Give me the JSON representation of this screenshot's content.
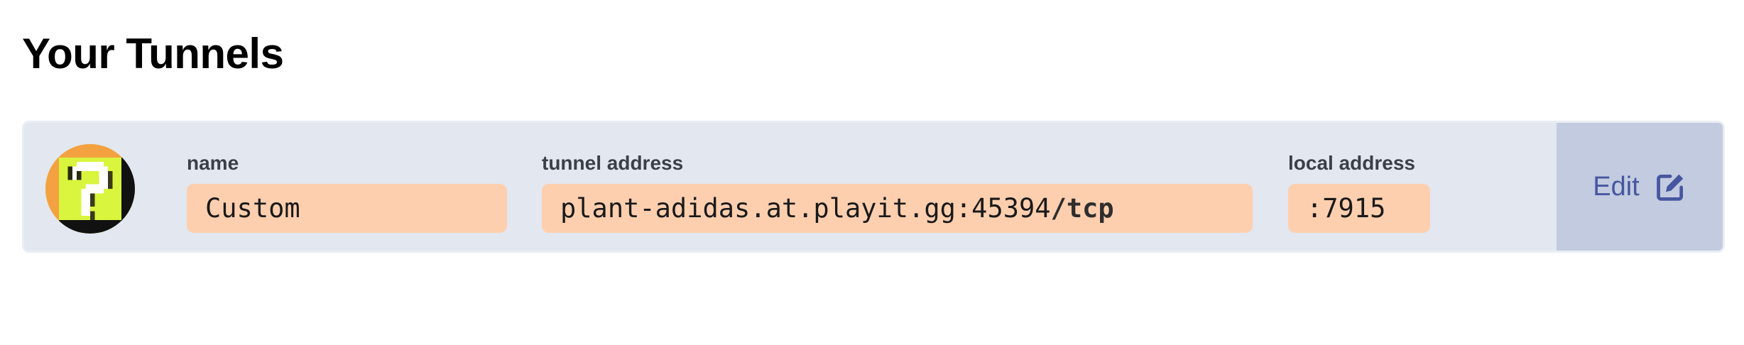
{
  "page": {
    "title": "Your Tunnels"
  },
  "tunnel": {
    "avatar_icon": "question-block-icon",
    "name_label": "name",
    "name_value": "Custom",
    "tunnel_address_label": "tunnel address",
    "tunnel_address_host": "plant-adidas.at.playit.gg:45394",
    "tunnel_address_separator": "/",
    "tunnel_address_protocol": "tcp",
    "local_address_label": "local address",
    "local_address_value": ":7915",
    "edit_label": "Edit",
    "edit_icon": "edit-icon"
  },
  "colors": {
    "card_background": "#e2e7f0",
    "value_background": "#fecfae",
    "edit_background": "#c3cbe0",
    "edit_text": "#4656a0",
    "avatar_green": "#d9f53d",
    "avatar_orange": "#f4a141"
  }
}
